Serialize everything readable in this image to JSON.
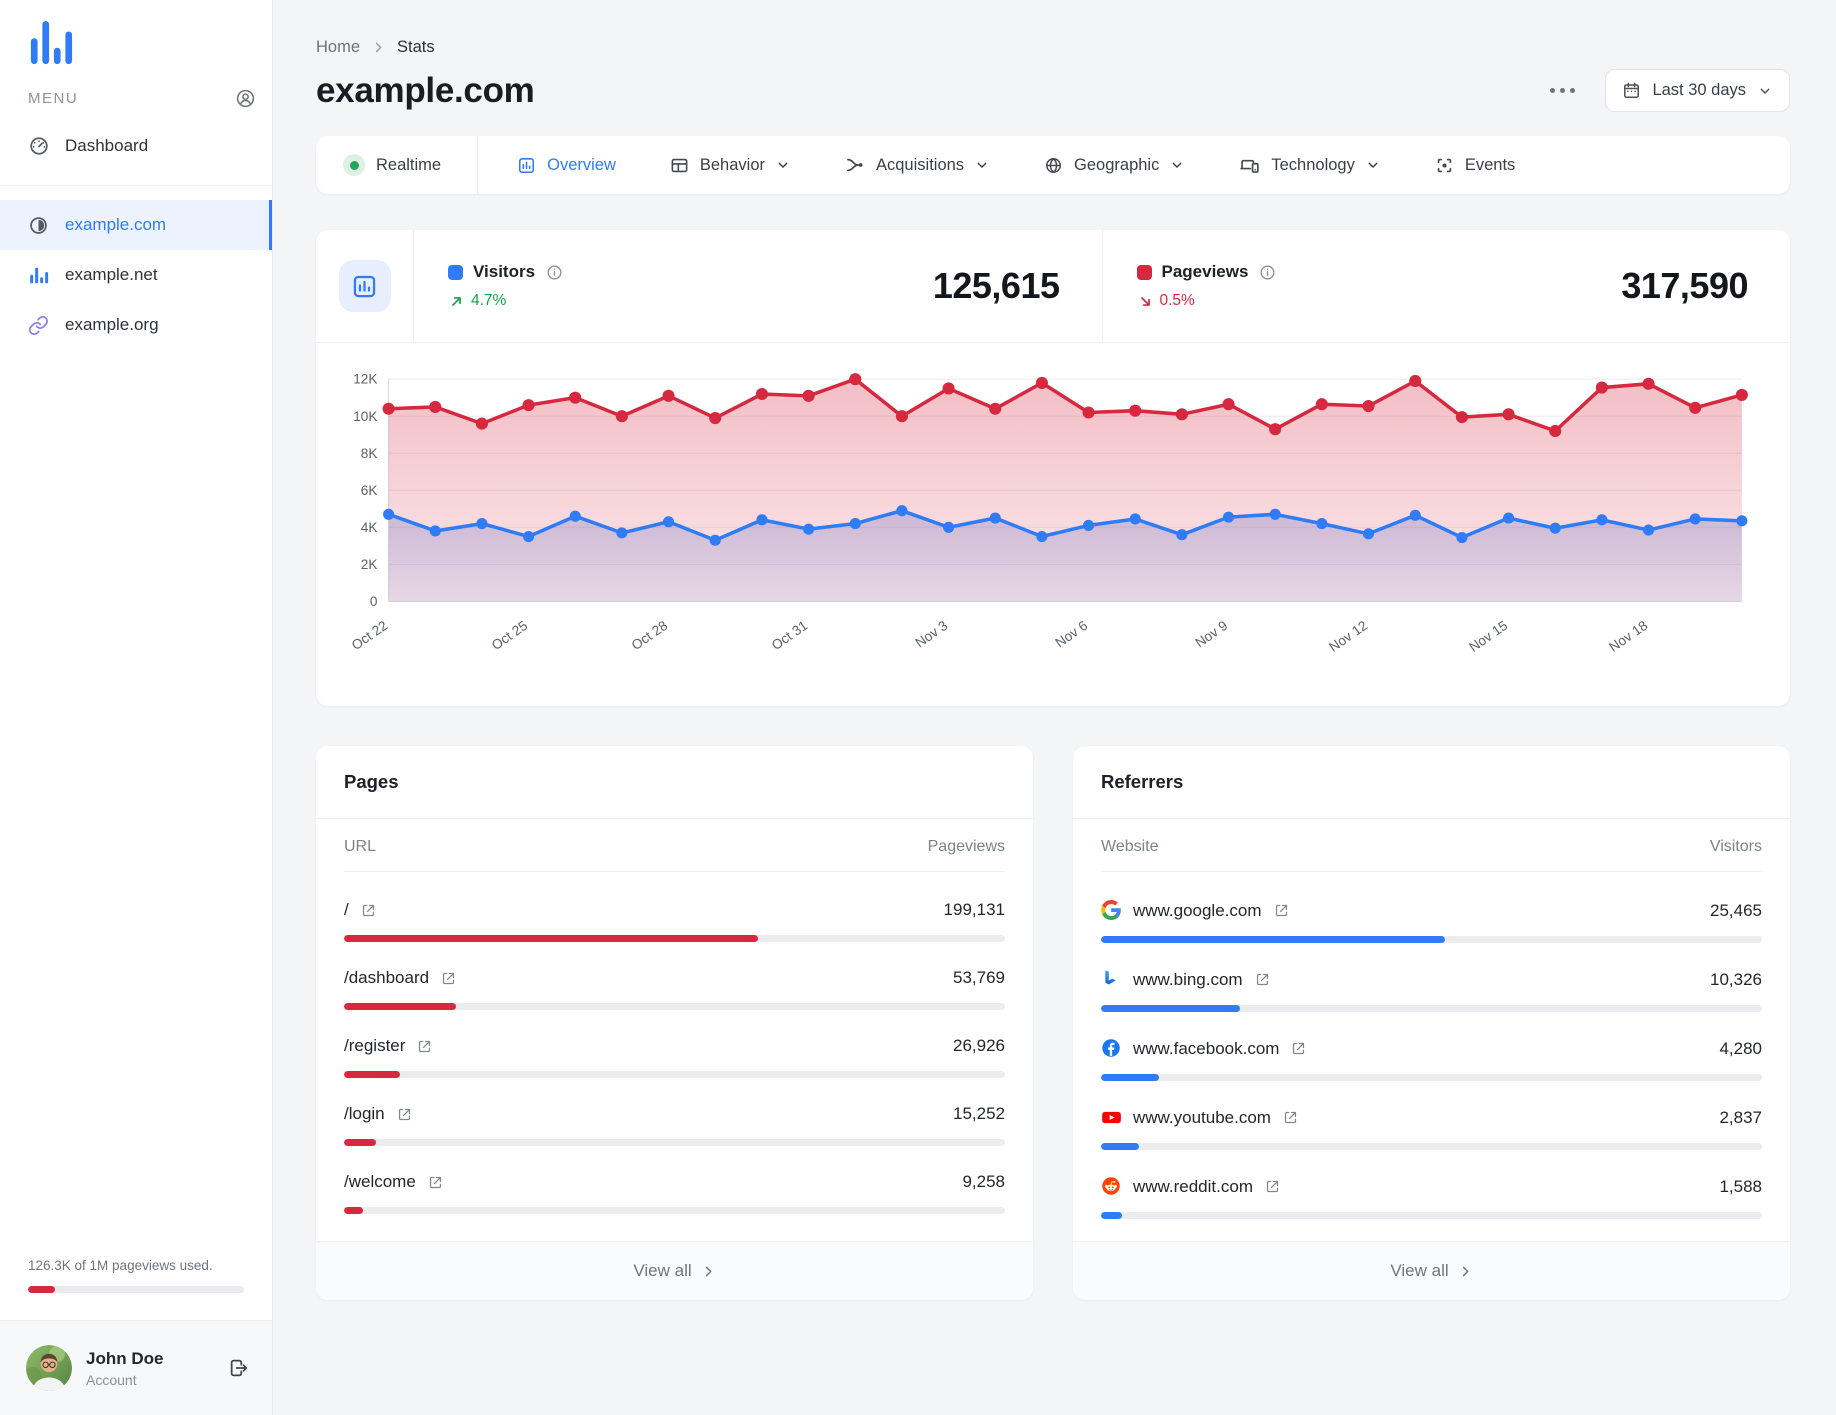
{
  "colors": {
    "accent_blue": "#2f7cf6",
    "accent_red": "#d6293f",
    "green": "#18a24b",
    "link_purple": "#8b7cf4"
  },
  "sidebar": {
    "menu_label": "MENU",
    "dashboard_label": "Dashboard",
    "sites": [
      {
        "label": "example.com",
        "icon": "contrast",
        "active": true
      },
      {
        "label": "example.net",
        "icon": "bars",
        "active": false
      },
      {
        "label": "example.org",
        "icon": "link",
        "active": false
      }
    ],
    "usage": {
      "text": "126.3K of 1M pageviews used.",
      "percent": 12.6
    },
    "account": {
      "name": "John Doe",
      "role": "Account"
    }
  },
  "header": {
    "breadcrumb_home": "Home",
    "breadcrumb_current": "Stats",
    "title": "example.com",
    "date_range": "Last 30 days"
  },
  "tabs": [
    {
      "label": "Realtime",
      "icon": "realtime",
      "active": false,
      "dropdown": false
    },
    {
      "label": "Overview",
      "icon": "overview",
      "active": true,
      "dropdown": false
    },
    {
      "label": "Behavior",
      "icon": "behavior",
      "active": false,
      "dropdown": true
    },
    {
      "label": "Acquisitions",
      "icon": "acquisitions",
      "active": false,
      "dropdown": true
    },
    {
      "label": "Geographic",
      "icon": "geographic",
      "active": false,
      "dropdown": true
    },
    {
      "label": "Technology",
      "icon": "technology",
      "active": false,
      "dropdown": true
    },
    {
      "label": "Events",
      "icon": "events",
      "active": false,
      "dropdown": false
    }
  ],
  "stats": {
    "visitors": {
      "label": "Visitors",
      "value": "125,615",
      "change": "4.7%",
      "direction": "up"
    },
    "pageviews": {
      "label": "Pageviews",
      "value": "317,590",
      "change": "0.5%",
      "direction": "down"
    }
  },
  "chart_data": {
    "type": "line",
    "x": [
      "Oct 22",
      "Oct 23",
      "Oct 24",
      "Oct 25",
      "Oct 26",
      "Oct 27",
      "Oct 28",
      "Oct 29",
      "Oct 30",
      "Oct 31",
      "Nov 1",
      "Nov 2",
      "Nov 3",
      "Nov 4",
      "Nov 5",
      "Nov 6",
      "Nov 7",
      "Nov 8",
      "Nov 9",
      "Nov 10",
      "Nov 11",
      "Nov 12",
      "Nov 13",
      "Nov 14",
      "Nov 15",
      "Nov 16",
      "Nov 17",
      "Nov 18",
      "Nov 19",
      "Nov 20"
    ],
    "x_tick_indices": [
      0,
      3,
      6,
      9,
      12,
      15,
      18,
      21,
      24,
      27
    ],
    "series": [
      {
        "name": "Pageviews",
        "color": "#d6293f",
        "fill_from": "rgba(214,41,63,0.30)",
        "fill_to": "rgba(214,41,63,0.10)",
        "values": [
          10400,
          10500,
          9600,
          10600,
          11000,
          10000,
          11100,
          9900,
          11200,
          11100,
          12000,
          10000,
          11500,
          10400,
          11800,
          10200,
          10300,
          10100,
          10650,
          9300,
          10650,
          10550,
          11900,
          9950,
          10100,
          9200,
          11550,
          11750,
          10450,
          11150
        ]
      },
      {
        "name": "Visitors",
        "color": "#2f7cf6",
        "fill_from": "rgba(104,112,196,0.30)",
        "fill_to": "rgba(104,112,196,0.14)",
        "values": [
          4700,
          3800,
          4200,
          3500,
          4600,
          3700,
          4300,
          3300,
          4400,
          3900,
          4200,
          4900,
          4000,
          4500,
          3500,
          4100,
          4450,
          3600,
          4550,
          4700,
          4200,
          3650,
          4650,
          3450,
          4500,
          3950,
          4400,
          3850,
          4450,
          4350
        ]
      }
    ],
    "ylim": [
      0,
      12000
    ],
    "yticks": [
      "0",
      "2K",
      "4K",
      "6K",
      "8K",
      "10K",
      "12K"
    ],
    "grid": true,
    "legend_position": "top"
  },
  "pages": {
    "title": "Pages",
    "columns": [
      "URL",
      "Pageviews"
    ],
    "rows": [
      {
        "url": "/",
        "value": "199,131",
        "pct": 62.7
      },
      {
        "url": "/dashboard",
        "value": "53,769",
        "pct": 16.9
      },
      {
        "url": "/register",
        "value": "26,926",
        "pct": 8.5
      },
      {
        "url": "/login",
        "value": "15,252",
        "pct": 4.8
      },
      {
        "url": "/welcome",
        "value": "9,258",
        "pct": 2.9
      }
    ],
    "view_all": "View all"
  },
  "referrers": {
    "title": "Referrers",
    "columns": [
      "Website",
      "Visitors"
    ],
    "rows": [
      {
        "site": "www.google.com",
        "value": "25,465",
        "pct": 52,
        "icon": "google"
      },
      {
        "site": "www.bing.com",
        "value": "10,326",
        "pct": 21,
        "icon": "bing"
      },
      {
        "site": "www.facebook.com",
        "value": "4,280",
        "pct": 8.8,
        "icon": "facebook"
      },
      {
        "site": "www.youtube.com",
        "value": "2,837",
        "pct": 5.8,
        "icon": "youtube"
      },
      {
        "site": "www.reddit.com",
        "value": "1,588",
        "pct": 3.2,
        "icon": "reddit"
      }
    ],
    "view_all": "View all"
  }
}
